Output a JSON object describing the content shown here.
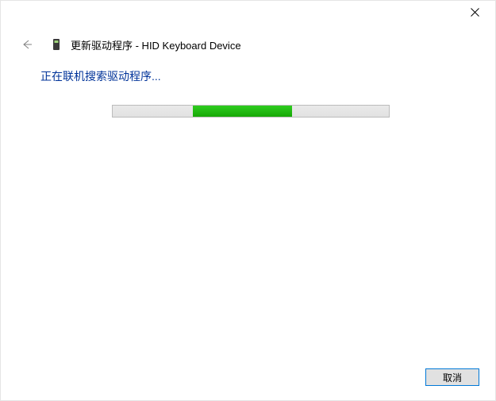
{
  "window": {
    "close_label": "Close"
  },
  "header": {
    "back_label": "Back",
    "title": "更新驱动程序 - HID Keyboard Device"
  },
  "content": {
    "status_text": "正在联机搜索驱动程序...",
    "progress": {
      "indeterminate": true,
      "segment_start_percent": 29,
      "segment_width_percent": 36
    }
  },
  "footer": {
    "cancel_label": "取消"
  }
}
